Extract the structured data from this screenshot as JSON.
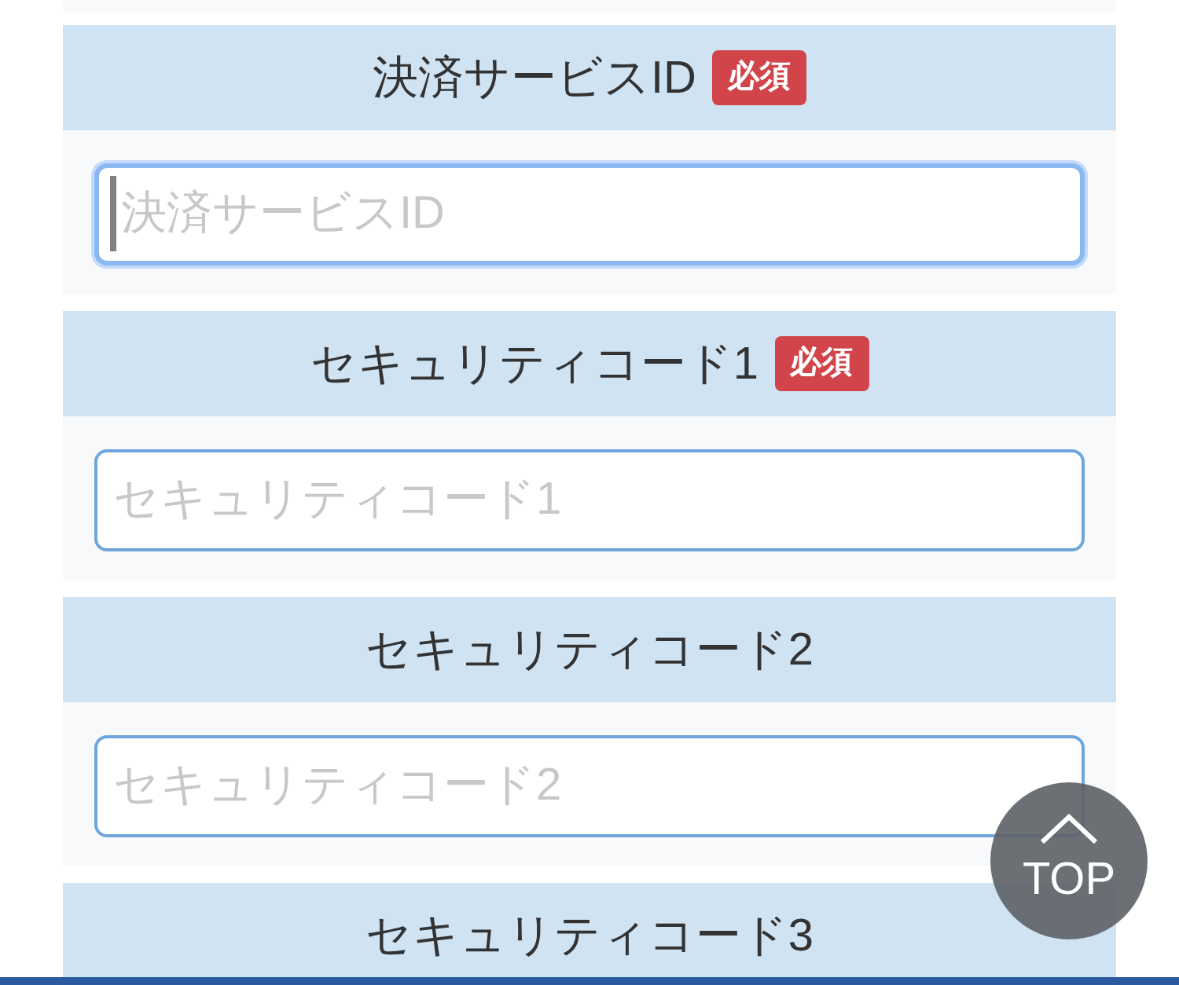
{
  "sections": [
    {
      "label": "決済サービスID",
      "badge": "必須",
      "placeholder": "決済サービスID",
      "focused": true
    },
    {
      "label": "セキュリティコード1",
      "badge": "必須",
      "placeholder": "セキュリティコード1",
      "focused": false
    },
    {
      "label": "セキュリティコード2",
      "placeholder": "セキュリティコード2",
      "focused": false
    },
    {
      "label": "セキュリティコード3"
    }
  ],
  "back_to_top": {
    "label": "TOP"
  }
}
